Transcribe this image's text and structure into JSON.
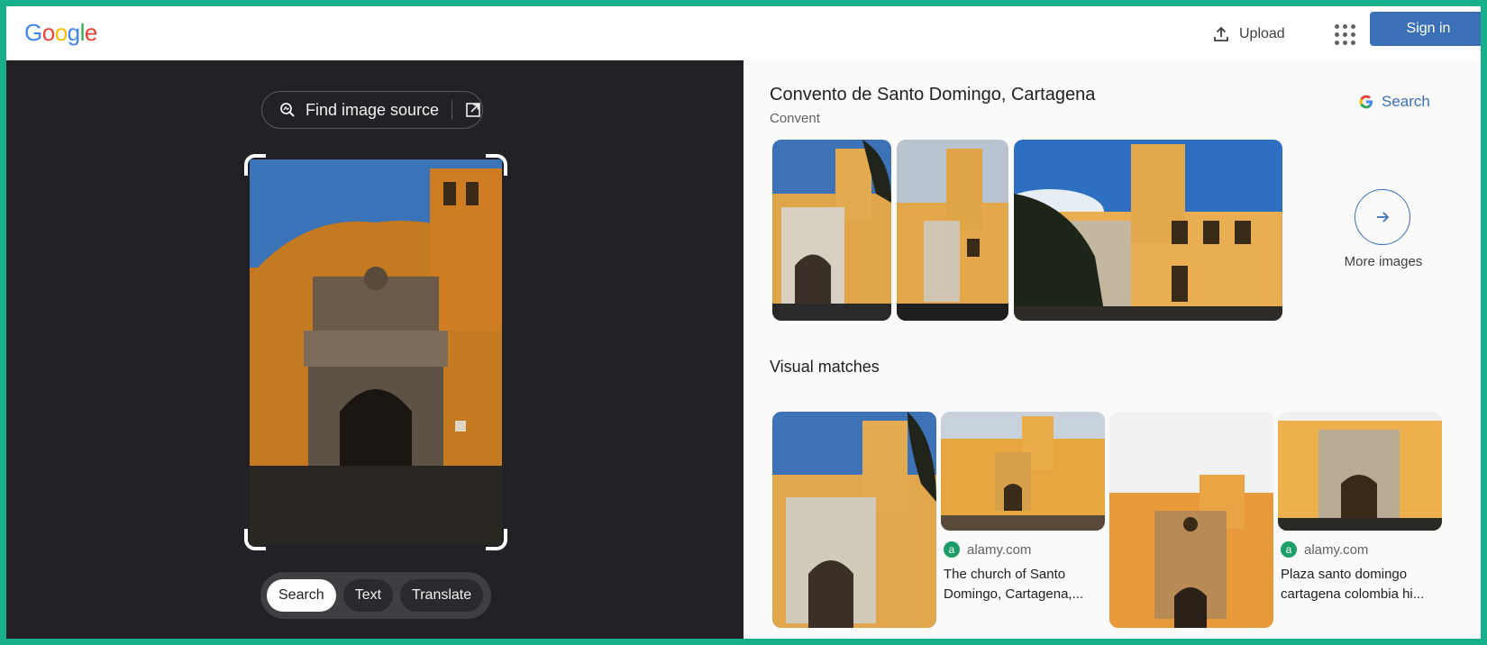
{
  "header": {
    "logo_letters": [
      {
        "char": "G",
        "color": "#4285f4"
      },
      {
        "char": "o",
        "color": "#ea4335"
      },
      {
        "char": "o",
        "color": "#fbbc05"
      },
      {
        "char": "g",
        "color": "#4285f4"
      },
      {
        "char": "l",
        "color": "#34a853"
      },
      {
        "char": "e",
        "color": "#ea4335"
      }
    ],
    "upload_label": "Upload",
    "upload_icon": "upload-icon",
    "apps_icon": "apps-grid-icon",
    "signin_label": "Sign in"
  },
  "lens": {
    "find_source_label": "Find image source",
    "find_source_icon": "lens-search-icon",
    "open_icon": "open-in-new-icon",
    "modes": [
      {
        "label": "Search",
        "active": true
      },
      {
        "label": "Text",
        "active": false
      },
      {
        "label": "Translate",
        "active": false
      }
    ]
  },
  "knowledge_panel": {
    "title": "Convento de Santo Domingo, Cartagena",
    "subtitle": "Convent",
    "search_label": "Search",
    "more_images_label": "More images"
  },
  "visual_matches": {
    "title": "Visual matches",
    "items": [
      {
        "source": "",
        "caption": ""
      },
      {
        "source": "alamy.com",
        "caption": "The church of Santo Domingo, Cartagena,..."
      },
      {
        "source": "",
        "caption": ""
      },
      {
        "source": "alamy.com",
        "caption": "Plaza santo domingo cartagena colombia hi..."
      }
    ]
  },
  "colors": {
    "accent": "#3b6fb6",
    "dark_pane": "#222125",
    "frame_border": "#18b08a"
  }
}
